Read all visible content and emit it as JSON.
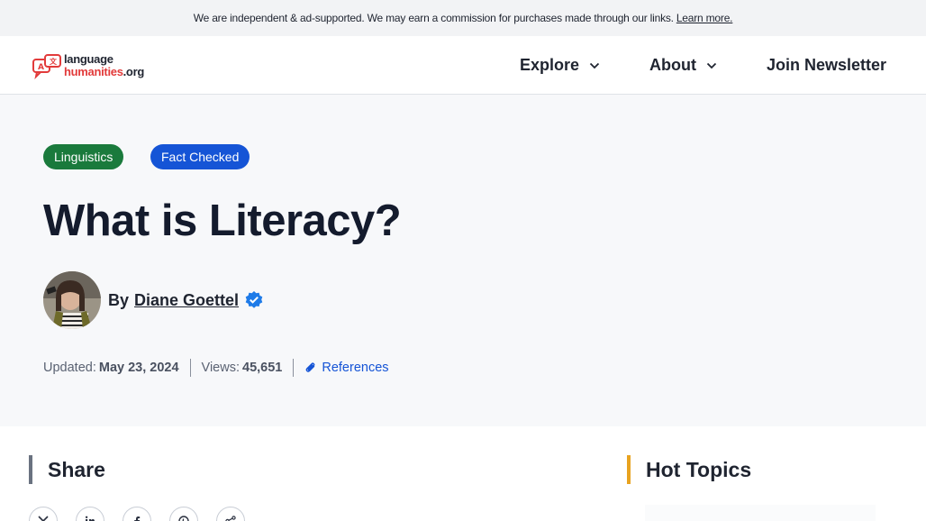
{
  "topbar": {
    "disclaimer": "We are independent & ad-supported. We may earn a commission for purchases made through our links.",
    "learn_more": "Learn more."
  },
  "header": {
    "logo_line1": "language",
    "logo_line2_main": "humanities",
    "logo_line2_ext": ".org",
    "nav": {
      "explore": "Explore",
      "about": "About",
      "newsletter": "Join Newsletter"
    }
  },
  "article": {
    "tags": {
      "category": "Linguistics",
      "fact_checked": "Fact Checked"
    },
    "title": "What is Literacy?",
    "author": {
      "by": "By",
      "name": "Diane Goettel"
    },
    "meta": {
      "updated_label": "Updated:",
      "updated_date": "May 23, 2024",
      "views_label": "Views:",
      "views_count": "45,651",
      "references": "References"
    }
  },
  "share": {
    "heading": "Share",
    "buttons": [
      "x-icon",
      "linkedin-icon",
      "facebook-icon",
      "pinterest-icon",
      "share-icon"
    ]
  },
  "hot_topics": {
    "heading": "Hot Topics"
  },
  "colors": {
    "tag_linguistics": "#1a7a3c",
    "tag_fact_checked": "#1554d6",
    "accent_hot_topics": "#e8a320",
    "logo_red": "#e23b3b"
  }
}
